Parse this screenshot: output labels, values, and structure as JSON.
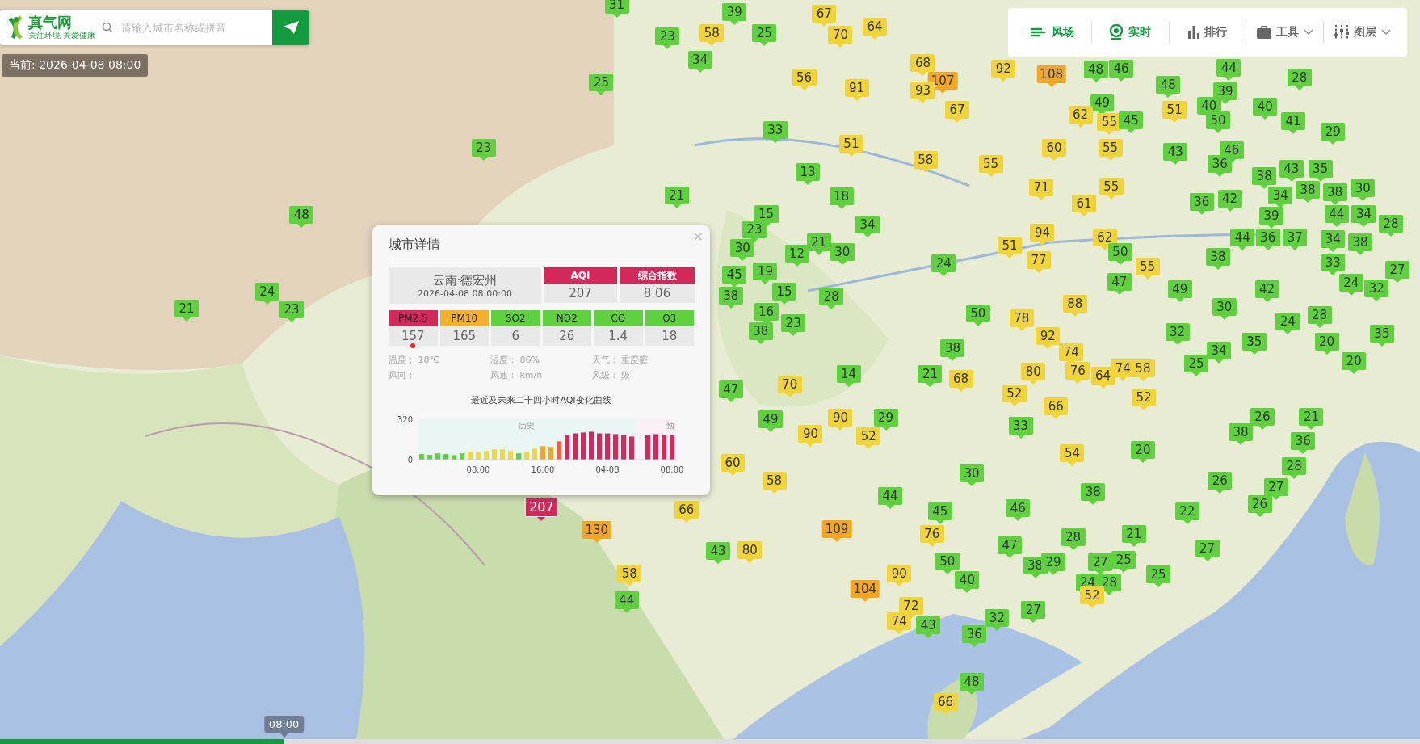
{
  "search": {
    "logo": "真气网",
    "slogan": "关注环境 关爱健康",
    "placeholder": "请输入城市名称或拼音"
  },
  "current_time": "当前: 2026-04-08 08:00",
  "toolbar": [
    {
      "label": "风场",
      "kind": "wind",
      "selected": true,
      "dropdown": false
    },
    {
      "label": "实时",
      "kind": "live",
      "selected": true,
      "dropdown": false
    },
    {
      "label": "排行",
      "kind": "rank",
      "selected": false,
      "dropdown": false
    },
    {
      "label": "工具",
      "kind": "tools",
      "selected": false,
      "dropdown": true
    },
    {
      "label": "图层",
      "kind": "layers",
      "selected": false,
      "dropdown": true
    }
  ],
  "markers": [
    {
      "value": "31",
      "color": "#5fd13f",
      "selected": false
    },
    {
      "value": "39",
      "color": "#5fd13f",
      "selected": false
    },
    {
      "value": "67",
      "color": "#f0d43a",
      "selected": false
    },
    {
      "value": "23",
      "color": "#5fd13f",
      "selected": false
    },
    {
      "value": "58",
      "color": "#f0d43a",
      "selected": false
    },
    {
      "value": "25",
      "color": "#5fd13f",
      "selected": false
    },
    {
      "value": "70",
      "color": "#f0d43a",
      "selected": false
    },
    {
      "value": "64",
      "color": "#f0d43a",
      "selected": false
    },
    {
      "value": "34",
      "color": "#5fd13f",
      "selected": false
    },
    {
      "value": "68",
      "color": "#f0d43a",
      "selected": false
    },
    {
      "value": "25",
      "color": "#5fd13f",
      "selected": false
    },
    {
      "value": "56",
      "color": "#f0d43a",
      "selected": false
    },
    {
      "value": "91",
      "color": "#f0d43a",
      "selected": false
    },
    {
      "value": "107",
      "color": "#f5a623",
      "selected": false
    },
    {
      "value": "92",
      "color": "#f0d43a",
      "selected": false
    },
    {
      "value": "108",
      "color": "#f5a623",
      "selected": false
    },
    {
      "value": "48",
      "color": "#5fd13f",
      "selected": false
    },
    {
      "value": "46",
      "color": "#5fd13f",
      "selected": false
    },
    {
      "value": "48",
      "color": "#5fd13f",
      "selected": false
    },
    {
      "value": "44",
      "color": "#5fd13f",
      "selected": false
    },
    {
      "value": "28",
      "color": "#5fd13f",
      "selected": false
    },
    {
      "value": "93",
      "color": "#f0d43a",
      "selected": false
    },
    {
      "value": "67",
      "color": "#f0d43a",
      "selected": false
    },
    {
      "value": "49",
      "color": "#5fd13f",
      "selected": false
    },
    {
      "value": "51",
      "color": "#f0d43a",
      "selected": false
    },
    {
      "value": "40",
      "color": "#5fd13f",
      "selected": false
    },
    {
      "value": "39",
      "color": "#5fd13f",
      "selected": false
    },
    {
      "value": "40",
      "color": "#5fd13f",
      "selected": false
    },
    {
      "value": "33",
      "color": "#5fd13f",
      "selected": false
    },
    {
      "value": "62",
      "color": "#f0d43a",
      "selected": false
    },
    {
      "value": "55",
      "color": "#f0d43a",
      "selected": false
    },
    {
      "value": "45",
      "color": "#5fd13f",
      "selected": false
    },
    {
      "value": "50",
      "color": "#5fd13f",
      "selected": false
    },
    {
      "value": "41",
      "color": "#5fd13f",
      "selected": false
    },
    {
      "value": "29",
      "color": "#5fd13f",
      "selected": false
    },
    {
      "value": "23",
      "color": "#5fd13f",
      "selected": false
    },
    {
      "value": "51",
      "color": "#f0d43a",
      "selected": false
    },
    {
      "value": "60",
      "color": "#f0d43a",
      "selected": false
    },
    {
      "value": "55",
      "color": "#f0d43a",
      "selected": false
    },
    {
      "value": "43",
      "color": "#5fd13f",
      "selected": false
    },
    {
      "value": "46",
      "color": "#5fd13f",
      "selected": false
    },
    {
      "value": "13",
      "color": "#5fd13f",
      "selected": false
    },
    {
      "value": "58",
      "color": "#f0d43a",
      "selected": false
    },
    {
      "value": "55",
      "color": "#f0d43a",
      "selected": false
    },
    {
      "value": "36",
      "color": "#5fd13f",
      "selected": false
    },
    {
      "value": "38",
      "color": "#5fd13f",
      "selected": false
    },
    {
      "value": "43",
      "color": "#5fd13f",
      "selected": false
    },
    {
      "value": "35",
      "color": "#5fd13f",
      "selected": false
    },
    {
      "value": "21",
      "color": "#5fd13f",
      "selected": false
    },
    {
      "value": "18",
      "color": "#5fd13f",
      "selected": false
    },
    {
      "value": "71",
      "color": "#f0d43a",
      "selected": false
    },
    {
      "value": "55",
      "color": "#f0d43a",
      "selected": false
    },
    {
      "value": "36",
      "color": "#5fd13f",
      "selected": false
    },
    {
      "value": "42",
      "color": "#5fd13f",
      "selected": false
    },
    {
      "value": "34",
      "color": "#5fd13f",
      "selected": false
    },
    {
      "value": "38",
      "color": "#5fd13f",
      "selected": false
    },
    {
      "value": "38",
      "color": "#5fd13f",
      "selected": false
    },
    {
      "value": "30",
      "color": "#5fd13f",
      "selected": false
    },
    {
      "value": "48",
      "color": "#5fd13f",
      "selected": false
    },
    {
      "value": "15",
      "color": "#5fd13f",
      "selected": false
    },
    {
      "value": "34",
      "color": "#5fd13f",
      "selected": false
    },
    {
      "value": "61",
      "color": "#f0d43a",
      "selected": false
    },
    {
      "value": "39",
      "color": "#5fd13f",
      "selected": false
    },
    {
      "value": "44",
      "color": "#5fd13f",
      "selected": false
    },
    {
      "value": "34",
      "color": "#5fd13f",
      "selected": false
    },
    {
      "value": "28",
      "color": "#5fd13f",
      "selected": false
    },
    {
      "value": "30",
      "color": "#5fd13f",
      "selected": false
    },
    {
      "value": "23",
      "color": "#5fd13f",
      "selected": false
    },
    {
      "value": "21",
      "color": "#5fd13f",
      "selected": false
    },
    {
      "value": "51",
      "color": "#f0d43a",
      "selected": false
    },
    {
      "value": "94",
      "color": "#f0d43a",
      "selected": false
    },
    {
      "value": "62",
      "color": "#f0d43a",
      "selected": false
    },
    {
      "value": "44",
      "color": "#5fd13f",
      "selected": false
    },
    {
      "value": "36",
      "color": "#5fd13f",
      "selected": false
    },
    {
      "value": "37",
      "color": "#5fd13f",
      "selected": false
    },
    {
      "value": "34",
      "color": "#5fd13f",
      "selected": false
    },
    {
      "value": "38",
      "color": "#5fd13f",
      "selected": false
    },
    {
      "value": "12",
      "color": "#5fd13f",
      "selected": false
    },
    {
      "value": "30",
      "color": "#5fd13f",
      "selected": false
    },
    {
      "value": "24",
      "color": "#5fd13f",
      "selected": false
    },
    {
      "value": "77",
      "color": "#f0d43a",
      "selected": false
    },
    {
      "value": "50",
      "color": "#5fd13f",
      "selected": false
    },
    {
      "value": "55",
      "color": "#f0d43a",
      "selected": false
    },
    {
      "value": "38",
      "color": "#5fd13f",
      "selected": false
    },
    {
      "value": "33",
      "color": "#5fd13f",
      "selected": false
    },
    {
      "value": "27",
      "color": "#5fd13f",
      "selected": false
    },
    {
      "value": "24",
      "color": "#5fd13f",
      "selected": false
    },
    {
      "value": "45",
      "color": "#5fd13f",
      "selected": false
    },
    {
      "value": "19",
      "color": "#5fd13f",
      "selected": false
    },
    {
      "value": "15",
      "color": "#5fd13f",
      "selected": false
    },
    {
      "value": "47",
      "color": "#5fd13f",
      "selected": false
    },
    {
      "value": "49",
      "color": "#5fd13f",
      "selected": false
    },
    {
      "value": "42",
      "color": "#5fd13f",
      "selected": false
    },
    {
      "value": "24",
      "color": "#5fd13f",
      "selected": false
    },
    {
      "value": "32",
      "color": "#5fd13f",
      "selected": false
    },
    {
      "value": "21",
      "color": "#5fd13f",
      "selected": false
    },
    {
      "value": "23",
      "color": "#5fd13f",
      "selected": false
    },
    {
      "value": "38",
      "color": "#5fd13f",
      "selected": false
    },
    {
      "value": "16",
      "color": "#5fd13f",
      "selected": false
    },
    {
      "value": "28",
      "color": "#5fd13f",
      "selected": false
    },
    {
      "value": "50",
      "color": "#5fd13f",
      "selected": false
    },
    {
      "value": "88",
      "color": "#f0d43a",
      "selected": false
    },
    {
      "value": "30",
      "color": "#5fd13f",
      "selected": false
    },
    {
      "value": "28",
      "color": "#5fd13f",
      "selected": false
    },
    {
      "value": "38",
      "color": "#5fd13f",
      "selected": false
    },
    {
      "value": "23",
      "color": "#5fd13f",
      "selected": false
    },
    {
      "value": "78",
      "color": "#f0d43a",
      "selected": false
    },
    {
      "value": "92",
      "color": "#f0d43a",
      "selected": false
    },
    {
      "value": "32",
      "color": "#5fd13f",
      "selected": false
    },
    {
      "value": "24",
      "color": "#5fd13f",
      "selected": false
    },
    {
      "value": "35",
      "color": "#5fd13f",
      "selected": false
    },
    {
      "value": "38",
      "color": "#5fd13f",
      "selected": false
    },
    {
      "value": "74",
      "color": "#f0d43a",
      "selected": false
    },
    {
      "value": "34",
      "color": "#5fd13f",
      "selected": false
    },
    {
      "value": "35",
      "color": "#5fd13f",
      "selected": false
    },
    {
      "value": "20",
      "color": "#5fd13f",
      "selected": false
    },
    {
      "value": "20",
      "color": "#5fd13f",
      "selected": false
    },
    {
      "value": "14",
      "color": "#5fd13f",
      "selected": false
    },
    {
      "value": "21",
      "color": "#5fd13f",
      "selected": false
    },
    {
      "value": "68",
      "color": "#f0d43a",
      "selected": false
    },
    {
      "value": "80",
      "color": "#f0d43a",
      "selected": false
    },
    {
      "value": "76",
      "color": "#f0d43a",
      "selected": false
    },
    {
      "value": "64",
      "color": "#f0d43a",
      "selected": false
    },
    {
      "value": "74",
      "color": "#f0d43a",
      "selected": false
    },
    {
      "value": "58",
      "color": "#f0d43a",
      "selected": false
    },
    {
      "value": "25",
      "color": "#5fd13f",
      "selected": false
    },
    {
      "value": "47",
      "color": "#5fd13f",
      "selected": false
    },
    {
      "value": "70",
      "color": "#f0d43a",
      "selected": false
    },
    {
      "value": "52",
      "color": "#f0d43a",
      "selected": false
    },
    {
      "value": "66",
      "color": "#f0d43a",
      "selected": false
    },
    {
      "value": "52",
      "color": "#f0d43a",
      "selected": false
    },
    {
      "value": "49",
      "color": "#5fd13f",
      "selected": false
    },
    {
      "value": "90",
      "color": "#f0d43a",
      "selected": false
    },
    {
      "value": "29",
      "color": "#5fd13f",
      "selected": false
    },
    {
      "value": "33",
      "color": "#5fd13f",
      "selected": false
    },
    {
      "value": "26",
      "color": "#5fd13f",
      "selected": false
    },
    {
      "value": "21",
      "color": "#5fd13f",
      "selected": false
    },
    {
      "value": "90",
      "color": "#f0d43a",
      "selected": false
    },
    {
      "value": "52",
      "color": "#f0d43a",
      "selected": false
    },
    {
      "value": "20",
      "color": "#5fd13f",
      "selected": false
    },
    {
      "value": "38",
      "color": "#5fd13f",
      "selected": false
    },
    {
      "value": "36",
      "color": "#5fd13f",
      "selected": false
    },
    {
      "value": "60",
      "color": "#f0d43a",
      "selected": false
    },
    {
      "value": "30",
      "color": "#5fd13f",
      "selected": false
    },
    {
      "value": "54",
      "color": "#f0d43a",
      "selected": false
    },
    {
      "value": "28",
      "color": "#5fd13f",
      "selected": false
    },
    {
      "value": "58",
      "color": "#f0d43a",
      "selected": false
    },
    {
      "value": "44",
      "color": "#5fd13f",
      "selected": false
    },
    {
      "value": "38",
      "color": "#5fd13f",
      "selected": false
    },
    {
      "value": "26",
      "color": "#5fd13f",
      "selected": false
    },
    {
      "value": "27",
      "color": "#5fd13f",
      "selected": false
    },
    {
      "value": "207",
      "color": "#d5285a",
      "selected": true
    },
    {
      "value": "66",
      "color": "#f0d43a",
      "selected": false
    },
    {
      "value": "45",
      "color": "#5fd13f",
      "selected": false
    },
    {
      "value": "46",
      "color": "#5fd13f",
      "selected": false
    },
    {
      "value": "22",
      "color": "#5fd13f",
      "selected": false
    },
    {
      "value": "26",
      "color": "#5fd13f",
      "selected": false
    },
    {
      "value": "130",
      "color": "#f5a623",
      "selected": false
    },
    {
      "value": "109",
      "color": "#f5a623",
      "selected": false
    },
    {
      "value": "76",
      "color": "#f0d43a",
      "selected": false
    },
    {
      "value": "28",
      "color": "#5fd13f",
      "selected": false
    },
    {
      "value": "21",
      "color": "#5fd13f",
      "selected": false
    },
    {
      "value": "43",
      "color": "#5fd13f",
      "selected": false
    },
    {
      "value": "80",
      "color": "#f0d43a",
      "selected": false
    },
    {
      "value": "50",
      "color": "#5fd13f",
      "selected": false
    },
    {
      "value": "47",
      "color": "#5fd13f",
      "selected": false
    },
    {
      "value": "38",
      "color": "#5fd13f",
      "selected": false
    },
    {
      "value": "29",
      "color": "#5fd13f",
      "selected": false
    },
    {
      "value": "27",
      "color": "#5fd13f",
      "selected": false
    },
    {
      "value": "25",
      "color": "#5fd13f",
      "selected": false
    },
    {
      "value": "27",
      "color": "#5fd13f",
      "selected": false
    },
    {
      "value": "58",
      "color": "#f0d43a",
      "selected": false
    },
    {
      "value": "90",
      "color": "#f0d43a",
      "selected": false
    },
    {
      "value": "40",
      "color": "#5fd13f",
      "selected": false
    },
    {
      "value": "24",
      "color": "#5fd13f",
      "selected": false
    },
    {
      "value": "28",
      "color": "#5fd13f",
      "selected": false
    },
    {
      "value": "25",
      "color": "#5fd13f",
      "selected": false
    },
    {
      "value": "44",
      "color": "#5fd13f",
      "selected": false
    },
    {
      "value": "104",
      "color": "#f5a623",
      "selected": false
    },
    {
      "value": "72",
      "color": "#f0d43a",
      "selected": false
    },
    {
      "value": "27",
      "color": "#5fd13f",
      "selected": false
    },
    {
      "value": "52",
      "color": "#f0d43a",
      "selected": false
    },
    {
      "value": "74",
      "color": "#f0d43a",
      "selected": false
    },
    {
      "value": "43",
      "color": "#5fd13f",
      "selected": false
    },
    {
      "value": "32",
      "color": "#5fd13f",
      "selected": false
    },
    {
      "value": "36",
      "color": "#5fd13f",
      "selected": false
    },
    {
      "value": "48",
      "color": "#5fd13f",
      "selected": false
    },
    {
      "value": "66",
      "color": "#f0d43a",
      "selected": false
    }
  ],
  "city_popup": {
    "title": "城市详情",
    "close": "×",
    "city": "云南·德宏州",
    "time": "2026-04-08 08:00:00",
    "indexes": [
      {
        "label": "AQI",
        "value": "207",
        "color": "#d5285a"
      },
      {
        "label": "综合指数",
        "value": "8.06",
        "color": "#d5285a"
      }
    ],
    "pollutants": [
      {
        "label": "PM2.5",
        "value": "157",
        "color": "#d5285a",
        "primary": true
      },
      {
        "label": "PM10",
        "value": "165",
        "color": "#f5b02e",
        "primary": false
      },
      {
        "label": "SO2",
        "value": "6",
        "color": "#5fd13f",
        "primary": false
      },
      {
        "label": "NO2",
        "value": "26",
        "color": "#5fd13f",
        "primary": false
      },
      {
        "label": "CO",
        "value": "1.4",
        "color": "#5fd13f",
        "primary": false
      },
      {
        "label": "O3",
        "value": "18",
        "color": "#5fd13f",
        "primary": false
      }
    ],
    "weather": [
      {
        "label": "温度：",
        "value": "18℃"
      },
      {
        "label": "湿度：",
        "value": "86%"
      },
      {
        "label": "天气：",
        "value": "重度霾"
      },
      {
        "label": "风向："
      },
      {
        "label": "风速：",
        "value": "km/h"
      },
      {
        "label": "风级：",
        "value": "级"
      }
    ],
    "chart_data": {
      "type": "bar",
      "title": "最近及未来二十四小时AQI变化曲线",
      "ylim": [
        0,
        320
      ],
      "yticks": [
        0,
        320
      ],
      "categories": [
        null,
        null,
        null,
        null,
        null,
        null,
        null,
        "08:00",
        null,
        null,
        null,
        null,
        null,
        null,
        null,
        "16:00",
        null,
        null,
        null,
        null,
        null,
        null,
        null,
        "04-08",
        null,
        null,
        null,
        null,
        null,
        null,
        null,
        "08:00"
      ],
      "values": [
        44,
        38,
        50,
        44,
        36,
        50,
        63,
        57,
        69,
        82,
        82,
        69,
        50,
        63,
        88,
        107,
        101,
        145,
        198,
        208,
        215,
        221,
        208,
        208,
        202,
        196,
        183,
        null,
        198,
        202,
        196,
        196
      ],
      "annotations": [
        "历史",
        "预"
      ]
    }
  },
  "timeline": {
    "time": "08:00",
    "level": 0.2
  }
}
